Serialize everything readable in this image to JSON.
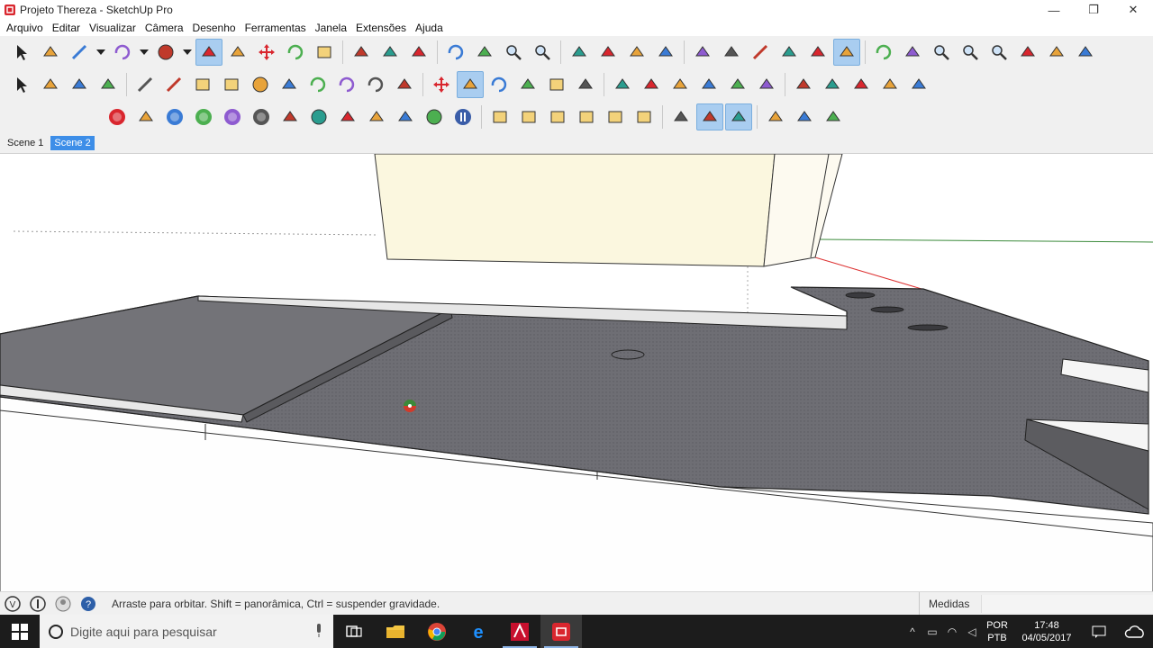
{
  "window": {
    "title": "Projeto Thereza - SketchUp Pro",
    "minimize": "—",
    "restore": "❐",
    "close": "✕"
  },
  "menu": [
    "Arquivo",
    "Editar",
    "Visualizar",
    "Câmera",
    "Desenho",
    "Ferramentas",
    "Janela",
    "Extensões",
    "Ajuda"
  ],
  "scenes": [
    {
      "label": "Scene 1",
      "active": false
    },
    {
      "label": "Scene 2",
      "active": true
    }
  ],
  "toolbar": {
    "row1": [
      "select-icon",
      "eraser-icon",
      "pencil-icon",
      "dropdown",
      "arc-icon",
      "dropdown",
      "circle-icon",
      "dropdown",
      "push-pull-icon",
      "follow-me-icon",
      "move-icon",
      "rotate-icon",
      "scale-icon",
      "sep",
      "tape-measure-icon",
      "text-icon",
      "paint-bucket-icon",
      "sep",
      "orbit-icon",
      "pan-icon",
      "zoom-icon",
      "zoom-extents-icon",
      "sep",
      "model-info-icon",
      "components-icon",
      "materials-icon",
      "styles-icon",
      "sep",
      "xray-icon",
      "wireframe-icon",
      "hidden-line-icon",
      "shaded-icon",
      "shaded-textures-icon",
      "monochrome-icon",
      "sep",
      "orbit-icon",
      "pan-icon",
      "zoom-icon",
      "zoom-window-icon",
      "zoom-extents-icon",
      "position-camera-icon",
      "walk-icon",
      "look-around-icon"
    ],
    "row2": [
      "select-icon",
      "make-component-icon",
      "paint-bucket-icon",
      "eraser-icon",
      "sep",
      "line-icon",
      "freehand-icon",
      "rectangle-icon",
      "rotated-rectangle-icon",
      "circle-icon",
      "polygon-icon",
      "arc-icon",
      "two-point-arc-icon",
      "three-point-arc-icon",
      "pie-icon",
      "sep",
      "move-icon",
      "push-pull-icon",
      "rotate-icon",
      "follow-me-icon",
      "scale-icon",
      "offset-icon",
      "sep",
      "tape-measure-icon",
      "dimension-icon",
      "protractor-icon",
      "text-icon",
      "axes-icon",
      "3d-text-icon",
      "sep",
      "section-plane-icon",
      "display-section-planes-icon",
      "display-section-cuts-icon",
      "section-fill-icon",
      "extension-icon"
    ],
    "row3": [
      "ruby-m-icon",
      "tag-icon",
      "ruby-r-icon",
      "ruby-rt-icon",
      "ruby-br-icon",
      "help-icon",
      "label-icon",
      "sphere-icon",
      "axes-tool-icon",
      "landscape-icon",
      "plants-icon",
      "target-icon",
      "pause-icon",
      "sep",
      "iso-view-icon",
      "top-view-icon",
      "front-view-icon",
      "right-view-icon",
      "back-view-icon",
      "left-view-icon",
      "sep",
      "position-camera-icon",
      "look-around-icon",
      "walk-icon",
      "sep",
      "sandbox-icon",
      "extension-warehouse-icon",
      "3d-warehouse-icon"
    ]
  },
  "status": {
    "message": "Arraste para orbitar. Shift = panorâmica, Ctrl = suspender gravidade.",
    "measures_label": "Medidas"
  },
  "taskbar": {
    "search_placeholder": "Digite aqui para pesquisar",
    "lang_line1": "POR",
    "lang_line2": "PTB",
    "time": "17:48",
    "date": "04/05/2017"
  }
}
